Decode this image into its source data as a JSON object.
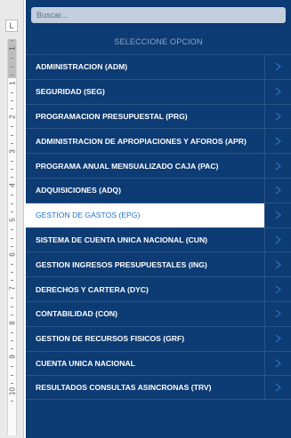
{
  "search": {
    "placeholder": "Buscar..."
  },
  "menu": {
    "header": "SELECCIONE OPCION",
    "active_index": 6,
    "items": [
      {
        "label": "ADMINISTRACION (ADM)"
      },
      {
        "label": "SEGURIDAD (SEG)"
      },
      {
        "label": "PROGRAMACION PRESUPUESTAL (PRG)"
      },
      {
        "label": "ADMINISTRACION DE APROPIACIONES Y AFOROS (APR)"
      },
      {
        "label": "PROGRAMA ANUAL MENSUALIZADO CAJA (PAC)"
      },
      {
        "label": "ADQUISICIONES (ADQ)"
      },
      {
        "label": "GESTION DE GASTOS (EPG)"
      },
      {
        "label": "SISTEMA DE CUENTA UNICA NACIONAL (CUN)"
      },
      {
        "label": "GESTION INGRESOS PRESUPUESTALES (ING)"
      },
      {
        "label": "DERECHOS Y CARTERA (DYC)"
      },
      {
        "label": "CONTABILIDAD (CON)"
      },
      {
        "label": "GESTION DE RECURSOS FISICOS (GRF)"
      },
      {
        "label": "CUENTA UNICA NACIONAL"
      },
      {
        "label": "RESULTADOS CONSULTAS ASINCRONAS (TRV)"
      }
    ]
  },
  "ruler": {
    "corner": "L",
    "numbers": [
      "1",
      "1",
      "2",
      "3",
      "4",
      "5",
      "6",
      "7",
      "8",
      "9",
      "10"
    ]
  },
  "colors": {
    "panel": "#0d3b73",
    "chevron": "#2a6db5",
    "active_text": "#1f73c9",
    "ruler": "#e9e9e9"
  }
}
